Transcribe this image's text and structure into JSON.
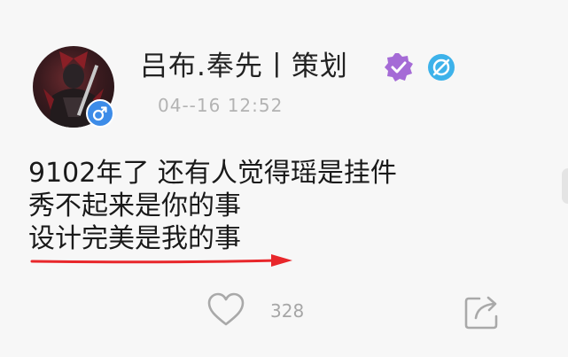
{
  "user": {
    "name": "吕布.奉先丨策划",
    "gender_icon": "male-symbol-icon",
    "verified_icon": "verified-badge-icon",
    "secondary_icon": "circle-badge-icon",
    "colors": {
      "verified": "#a56bd6",
      "secondary": "#3db2ea",
      "gender": "#3d8ce8"
    }
  },
  "post": {
    "timestamp": "04--16 12:52",
    "lines": [
      "9102年了 还有人觉得瑶是挂件",
      "秀不起来是你的事",
      "设计完美是我的事"
    ],
    "annotation": {
      "icon": "red-arrow-icon",
      "color": "#e8272b"
    }
  },
  "actions": {
    "like_icon": "heart-icon",
    "like_count": "328",
    "share_icon": "share-icon"
  }
}
